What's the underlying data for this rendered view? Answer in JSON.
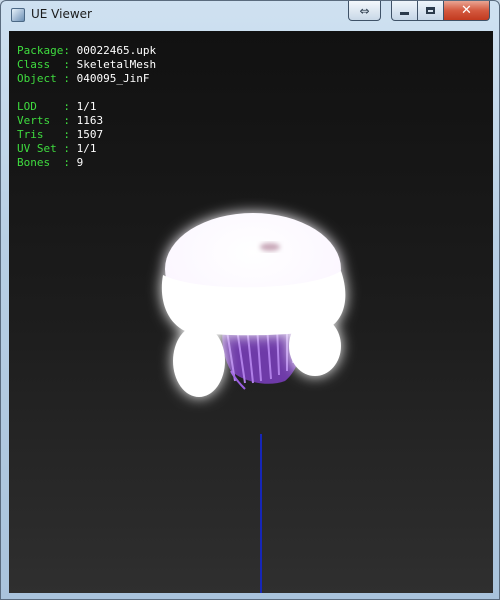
{
  "window": {
    "title": "UE Viewer",
    "buttons": {
      "resize_glyph": "⇔",
      "close_glyph": "✕"
    }
  },
  "info": {
    "package_key": "Package:",
    "package": "00022465.upk",
    "class_key": "Class  :",
    "class": "SkeletalMesh",
    "object_key": "Object :",
    "object": "040095_JinF",
    "lod_key": "LOD    :",
    "lod": "1/1",
    "verts_key": "Verts  :",
    "verts": "1163",
    "tris_key": "Tris   :",
    "tris": "1507",
    "uvset_key": "UV Set :",
    "uvset": "1/1",
    "bones_key": "Bones  :",
    "bones": "9"
  },
  "colors": {
    "label": "#3fdc3f",
    "value": "#ffffff",
    "axis": "#1626b8",
    "hat": "#ffffff",
    "hair": "#8a4fd1"
  },
  "icons": [
    "app-icon",
    "resize-icon",
    "minimize-icon",
    "maximize-icon",
    "close-icon"
  ]
}
